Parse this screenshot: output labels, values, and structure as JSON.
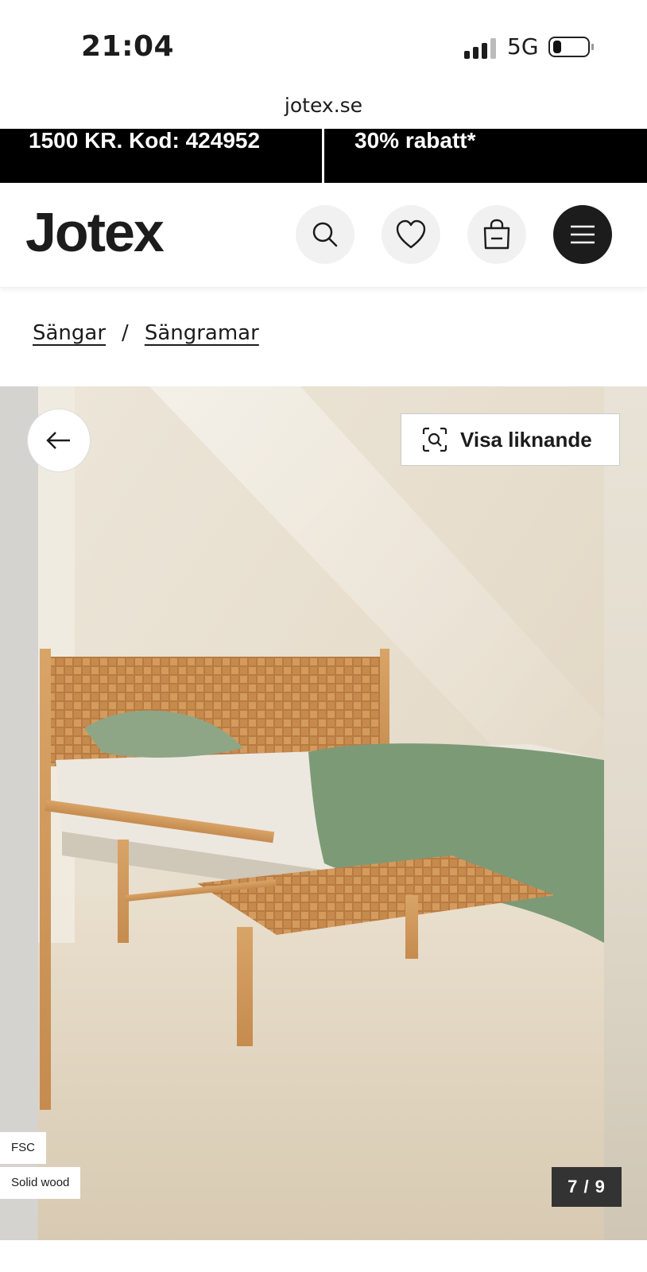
{
  "status_bar": {
    "time": "21:04",
    "network": "5G"
  },
  "browser": {
    "url": "jotex.se"
  },
  "promo": {
    "left_text": "1500 KR. Kod: 424952",
    "right_text": "30% rabatt*"
  },
  "header": {
    "logo": "Jotex",
    "icons": [
      "search-icon",
      "heart-icon",
      "bag-icon",
      "menu-icon"
    ]
  },
  "breadcrumb": {
    "items": [
      "Sängar",
      "Sängramar"
    ],
    "separator": "/"
  },
  "gallery": {
    "similar_label": "Visa liknande",
    "badges": [
      "FSC",
      "Solid wood"
    ],
    "counter": "7 / 9",
    "current_index": 7,
    "total": 9
  },
  "colors": {
    "brand": "#1c1c1c",
    "banner": "#000000",
    "icon_bg": "#f1f1f1"
  }
}
